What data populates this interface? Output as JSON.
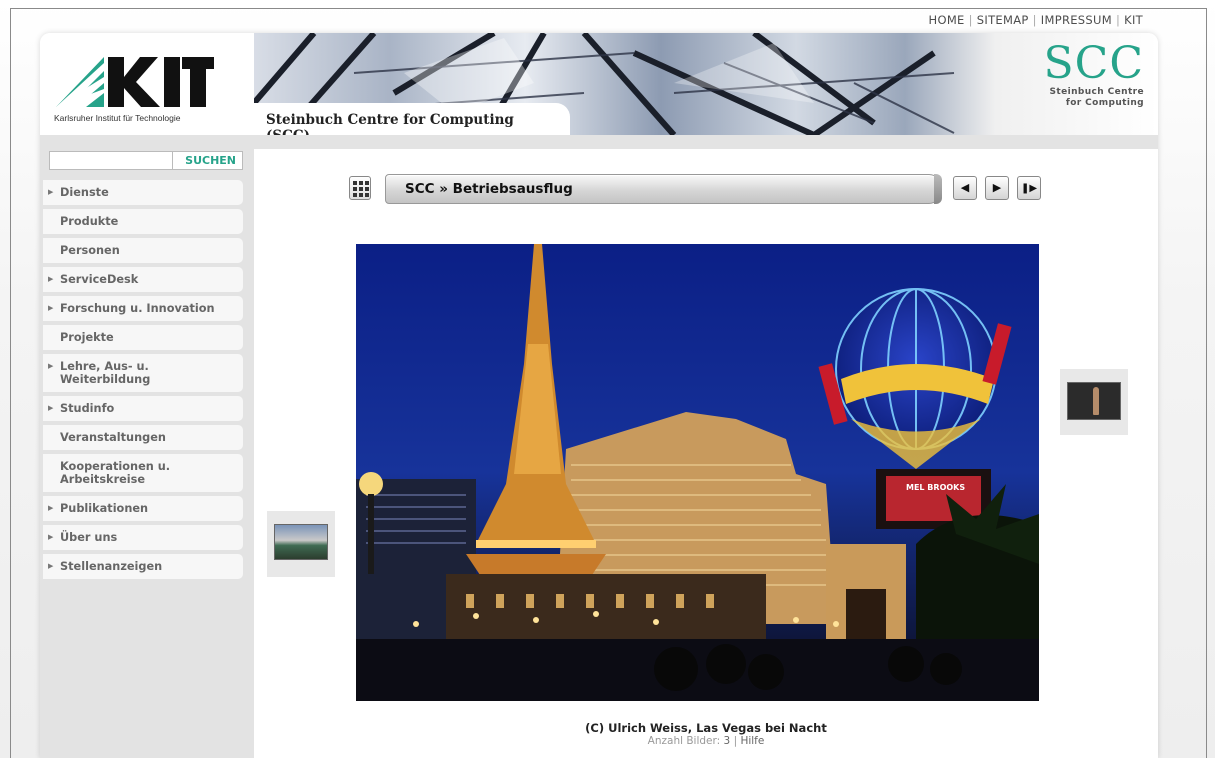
{
  "top_links": [
    "HOME",
    "SITEMAP",
    "IMPRESSUM",
    "KIT"
  ],
  "kit_logo": {
    "letters": "KIT",
    "subtitle": "Karlsruher Institut für Technologie",
    "color": "#26a38a"
  },
  "banner": {
    "title": "Steinbuch Centre for Computing (SCC)"
  },
  "scc_logo": {
    "letters": "SCC",
    "line1": "Steinbuch Centre",
    "line2": "for Computing"
  },
  "search": {
    "value": "",
    "button_label": "SUCHEN"
  },
  "nav": [
    {
      "label": "Dienste",
      "caret": true
    },
    {
      "label": "Produkte",
      "caret": false
    },
    {
      "label": "Personen",
      "caret": false
    },
    {
      "label": "ServiceDesk",
      "caret": true
    },
    {
      "label": "Forschung u. Innovation",
      "caret": true
    },
    {
      "label": "Projekte",
      "caret": false
    },
    {
      "label": "Lehre, Aus- u. Weiterbildung",
      "caret": true
    },
    {
      "label": "Studinfo",
      "caret": true
    },
    {
      "label": "Veranstaltungen",
      "caret": false
    },
    {
      "label": "Kooperationen u. Arbeitskreise",
      "caret": false
    },
    {
      "label": "Publikationen",
      "caret": true
    },
    {
      "label": "Über uns",
      "caret": true
    },
    {
      "label": "Stellenanzeigen",
      "caret": true
    }
  ],
  "gallery": {
    "breadcrumb": "SCC » Betriebsausflug",
    "caption": "(C) Ulrich Weiss, Las Vegas bei Nacht",
    "count_label": "Anzahl Bilder:",
    "count": "3",
    "separator": "|",
    "help_label": "Hilfe",
    "photo_sign": "MEL BROOKS"
  }
}
